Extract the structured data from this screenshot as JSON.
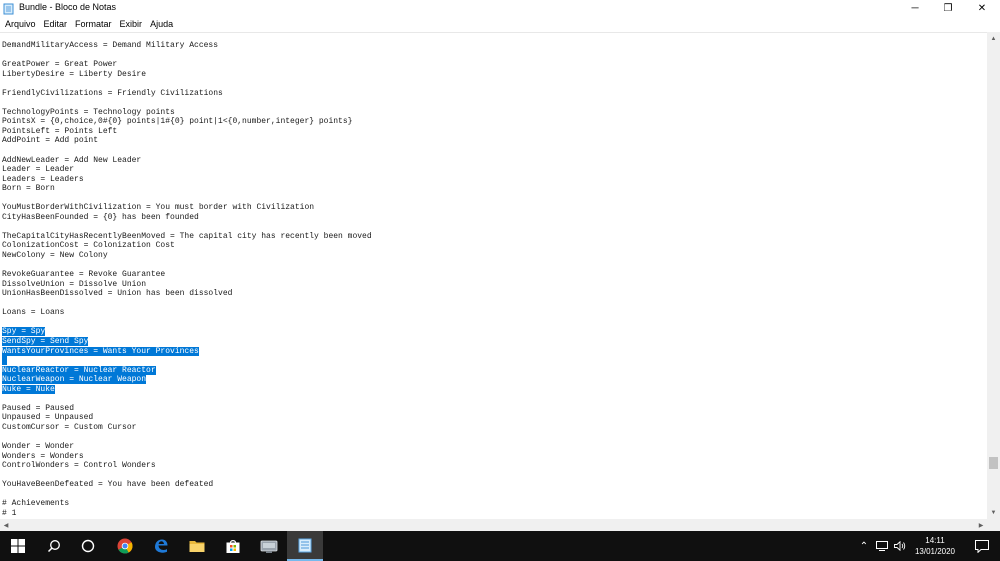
{
  "window": {
    "title": "Bundle - Bloco de Notas",
    "icon": "notepad-icon",
    "controls": {
      "minimize": "─",
      "maximize": "❐",
      "close": "✕"
    }
  },
  "menu": [
    "Arquivo",
    "Editar",
    "Formatar",
    "Exibir",
    "Ajuda"
  ],
  "lines": [
    {
      "text": "DemandMilitaryAccess = Demand Military Access"
    },
    {
      "text": ""
    },
    {
      "text": "GreatPower = Great Power"
    },
    {
      "text": "LibertyDesire = Liberty Desire"
    },
    {
      "text": ""
    },
    {
      "text": "FriendlyCivilizations = Friendly Civilizations"
    },
    {
      "text": ""
    },
    {
      "text": "TechnologyPoints = Technology points"
    },
    {
      "text": "PointsX = {0,choice,0#{0} points|1#{0} point|1<{0,number,integer} points}"
    },
    {
      "text": "PointsLeft = Points Left"
    },
    {
      "text": "AddPoint = Add point"
    },
    {
      "text": ""
    },
    {
      "text": "AddNewLeader = Add New Leader"
    },
    {
      "text": "Leader = Leader"
    },
    {
      "text": "Leaders = Leaders"
    },
    {
      "text": "Born = Born"
    },
    {
      "text": ""
    },
    {
      "text": "YouMustBorderWithCivilization = You must border with Civilization"
    },
    {
      "text": "CityHasBeenFounded = {0} has been founded"
    },
    {
      "text": ""
    },
    {
      "text": "TheCapitalCityHasRecentlyBeenMoved = The capital city has recently been moved"
    },
    {
      "text": "ColonizationCost = Colonization Cost"
    },
    {
      "text": "NewColony = New Colony"
    },
    {
      "text": ""
    },
    {
      "text": "RevokeGuarantee = Revoke Guarantee"
    },
    {
      "text": "DissolveUnion = Dissolve Union"
    },
    {
      "text": "UnionHasBeenDissolved = Union has been dissolved"
    },
    {
      "text": ""
    },
    {
      "text": "Loans = Loans"
    },
    {
      "text": ""
    },
    {
      "text": "Spy = Spy",
      "selected": true
    },
    {
      "text": "SendSpy = Send Spy",
      "selected": true
    },
    {
      "text": "WantsYourProvinces = Wants Your Provinces",
      "selected": true
    },
    {
      "text": "",
      "selected": true
    },
    {
      "text": "NuclearReactor = Nuclear Reactor",
      "selected": true
    },
    {
      "text": "NuclearWeapon = Nuclear Weapon",
      "selected": true
    },
    {
      "text": "Nuke = Nuke",
      "selected": true
    },
    {
      "text": ""
    },
    {
      "text": "Paused = Paused"
    },
    {
      "text": "Unpaused = Unpaused"
    },
    {
      "text": "CustomCursor = Custom Cursor"
    },
    {
      "text": ""
    },
    {
      "text": "Wonder = Wonder"
    },
    {
      "text": "Wonders = Wonders"
    },
    {
      "text": "ControlWonders = Control Wonders"
    },
    {
      "text": ""
    },
    {
      "text": "YouHaveBeenDefeated = You have been defeated"
    },
    {
      "text": ""
    },
    {
      "text": "# Achievements"
    },
    {
      "text": "# 1"
    }
  ],
  "scrollbars": {
    "vertical_position_fraction": 0.93,
    "up_glyph": "▲",
    "down_glyph": "▼",
    "left_glyph": "◀",
    "right_glyph": "▶"
  },
  "taskbar": {
    "apps": [
      "windows-start-icon",
      "search-icon",
      "task-view-icon",
      "chrome-icon",
      "edge-icon",
      "file-explorer-icon",
      "store-icon",
      "app-icon",
      "notepad-icon"
    ],
    "active_app": "notepad-icon",
    "tray": {
      "chevron": "⌃",
      "volume": "🔊"
    },
    "time": "14:11",
    "date": "13/01/2020"
  },
  "colors": {
    "selection": "#0078d7",
    "taskbar": "#101010",
    "chrome_blue": "#4285f4",
    "edge_blue": "#1f7ad8"
  }
}
